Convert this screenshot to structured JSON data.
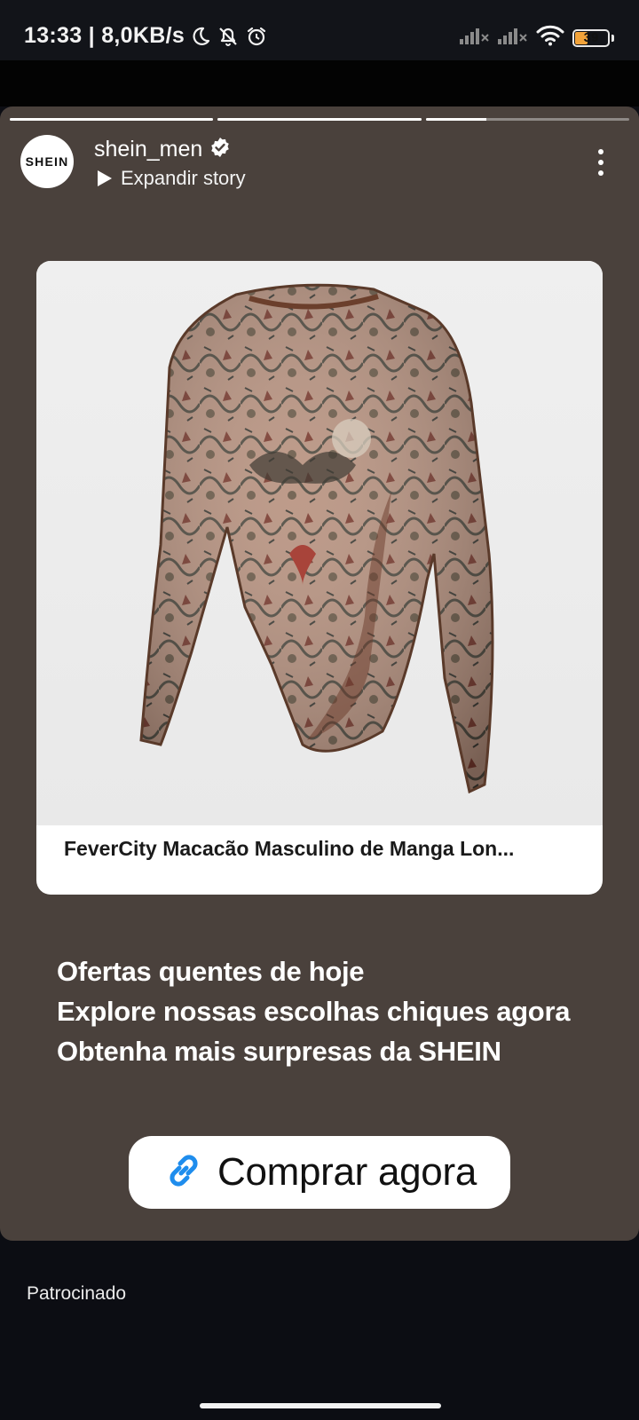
{
  "status_bar": {
    "time_speed": "13:33 | 8,0KB/s",
    "battery_level": "39",
    "icons": [
      "moon-icon",
      "bell-off-icon",
      "alarm-icon",
      "signal-icon",
      "wifi-icon",
      "battery-icon"
    ]
  },
  "story": {
    "progress": [
      1.0,
      1.0,
      0.3
    ],
    "avatar_text": "SHEIN",
    "username": "shein_men",
    "expand_label": "Expandir story",
    "product_title": "FeverCity Macacão Masculino de Manga Lon...",
    "promo_lines": [
      "Ofertas quentes de hoje",
      "Explore nossas escolhas chiques agora",
      "Obtenha mais surpresas da SHEIN"
    ],
    "cta_label": "Comprar agora"
  },
  "footer": {
    "sponsored_label": "Patrocinado"
  },
  "colors": {
    "story_background": "#4a413c",
    "link_accent": "#1f8ded",
    "battery_fill": "#f2a33a"
  }
}
